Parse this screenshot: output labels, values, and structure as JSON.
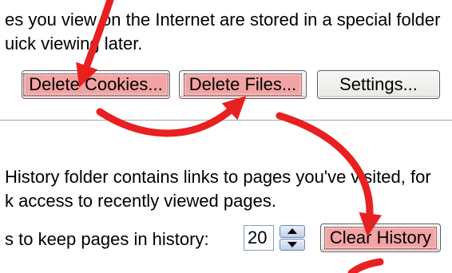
{
  "top_section": {
    "line1": "es you view on the Internet are stored in a special folder",
    "line2": "uick viewing later.",
    "buttons": {
      "delete_cookies": "Delete Cookies...",
      "delete_files": "Delete Files...",
      "settings": "Settings..."
    }
  },
  "history_section": {
    "line1": "History folder contains links to pages you've visited, for",
    "line2": "k access to recently viewed pages.",
    "days_label": "s to keep pages in history:",
    "days_value": "20",
    "clear_history": "Clear History"
  },
  "colors": {
    "annotation_arrow": "#e82020",
    "highlight": "#f2a3a3"
  }
}
